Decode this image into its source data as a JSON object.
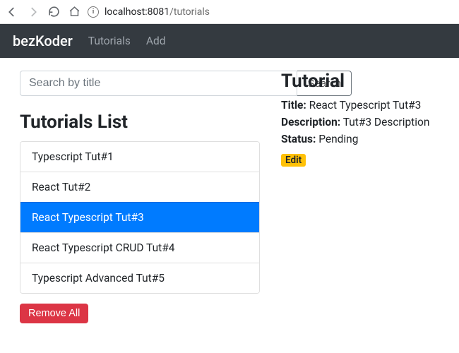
{
  "browser": {
    "url_host": "localhost:",
    "url_port": "8081",
    "url_path": "/tutorials"
  },
  "navbar": {
    "brand": "bezKoder",
    "links": [
      {
        "label": "Tutorials"
      },
      {
        "label": "Add"
      }
    ]
  },
  "search": {
    "placeholder": "Search by title",
    "button_label": "Search"
  },
  "list": {
    "title": "Tutorials List",
    "items": [
      {
        "title": "Typescript Tut#1",
        "active": false
      },
      {
        "title": "React Tut#2",
        "active": false
      },
      {
        "title": "React Typescript Tut#3",
        "active": true
      },
      {
        "title": "React Typescript CRUD Tut#4",
        "active": false
      },
      {
        "title": "Typescript Advanced Tut#5",
        "active": false
      }
    ],
    "remove_label": "Remove All"
  },
  "detail": {
    "heading": "Tutorial",
    "title_label": "Title:",
    "title_value": "React Typescript Tut#3",
    "description_label": "Description:",
    "description_value": "Tut#3 Description",
    "status_label": "Status:",
    "status_value": "Pending",
    "edit_label": "Edit"
  }
}
